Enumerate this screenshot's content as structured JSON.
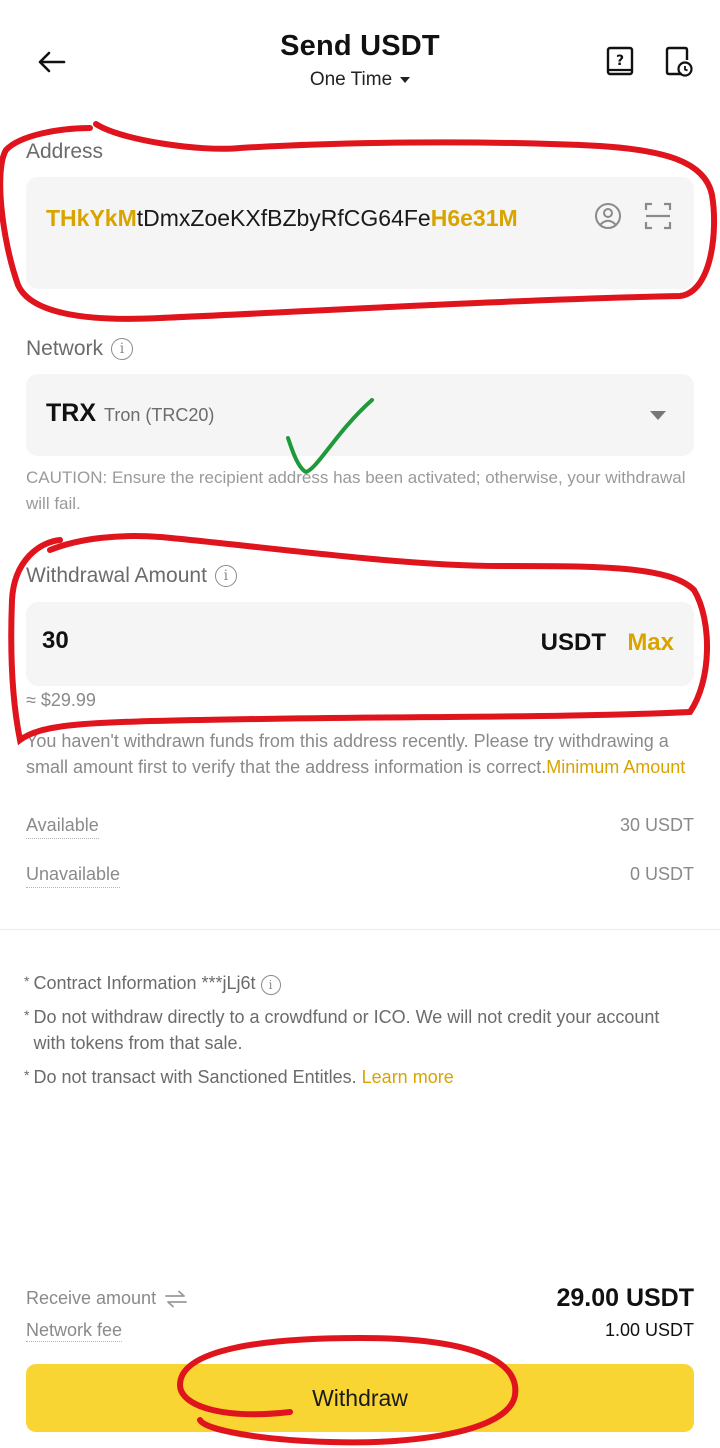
{
  "header": {
    "title": "Send USDT",
    "mode": "One Time"
  },
  "address": {
    "label": "Address",
    "prefix": "THkYkM",
    "middle": "tDmxZoeKXfBZbyRfCG64Fe",
    "suffix": "H6e31M"
  },
  "network": {
    "label": "Network",
    "code": "TRX",
    "name": "Tron (TRC20)",
    "caution": "CAUTION: Ensure the recipient address has been activated; otherwise, your withdrawal will fail."
  },
  "amount": {
    "label": "Withdrawal Amount",
    "value": "30",
    "unit": "USDT",
    "max_label": "Max",
    "approx": "≈ $29.99",
    "notice": "You haven't withdrawn funds from this address recently. Please try withdrawing a small amount first to verify that the address information is correct.",
    "minimum_link": "Minimum Amount"
  },
  "balances": {
    "available_label": "Available",
    "available_value": "30 USDT",
    "unavailable_label": "Unavailable",
    "unavailable_value": "0 USDT"
  },
  "notes": {
    "contract": "Contract Information ***jLj6t",
    "crowdfund": "Do not withdraw directly to a crowdfund or ICO. We will not credit your account with tokens from that sale.",
    "sanctioned": "Do not transact with Sanctioned Entitles.",
    "learn_more": "Learn more"
  },
  "summary": {
    "receive_label": "Receive amount",
    "receive_value": "29.00 USDT",
    "fee_label": "Network fee",
    "fee_value": "1.00 USDT"
  },
  "actions": {
    "withdraw_label": "Withdraw"
  },
  "colors": {
    "accent": "#d9a300",
    "button": "#f9d534",
    "annotation_red": "#e0141c",
    "annotation_green": "#1e9a3a"
  },
  "icons": {
    "back": "arrow-left-icon",
    "guide": "question-book-icon",
    "history": "history-doc-icon",
    "contact": "contact-icon",
    "scan": "scan-icon",
    "swap": "swap-arrows-icon"
  }
}
